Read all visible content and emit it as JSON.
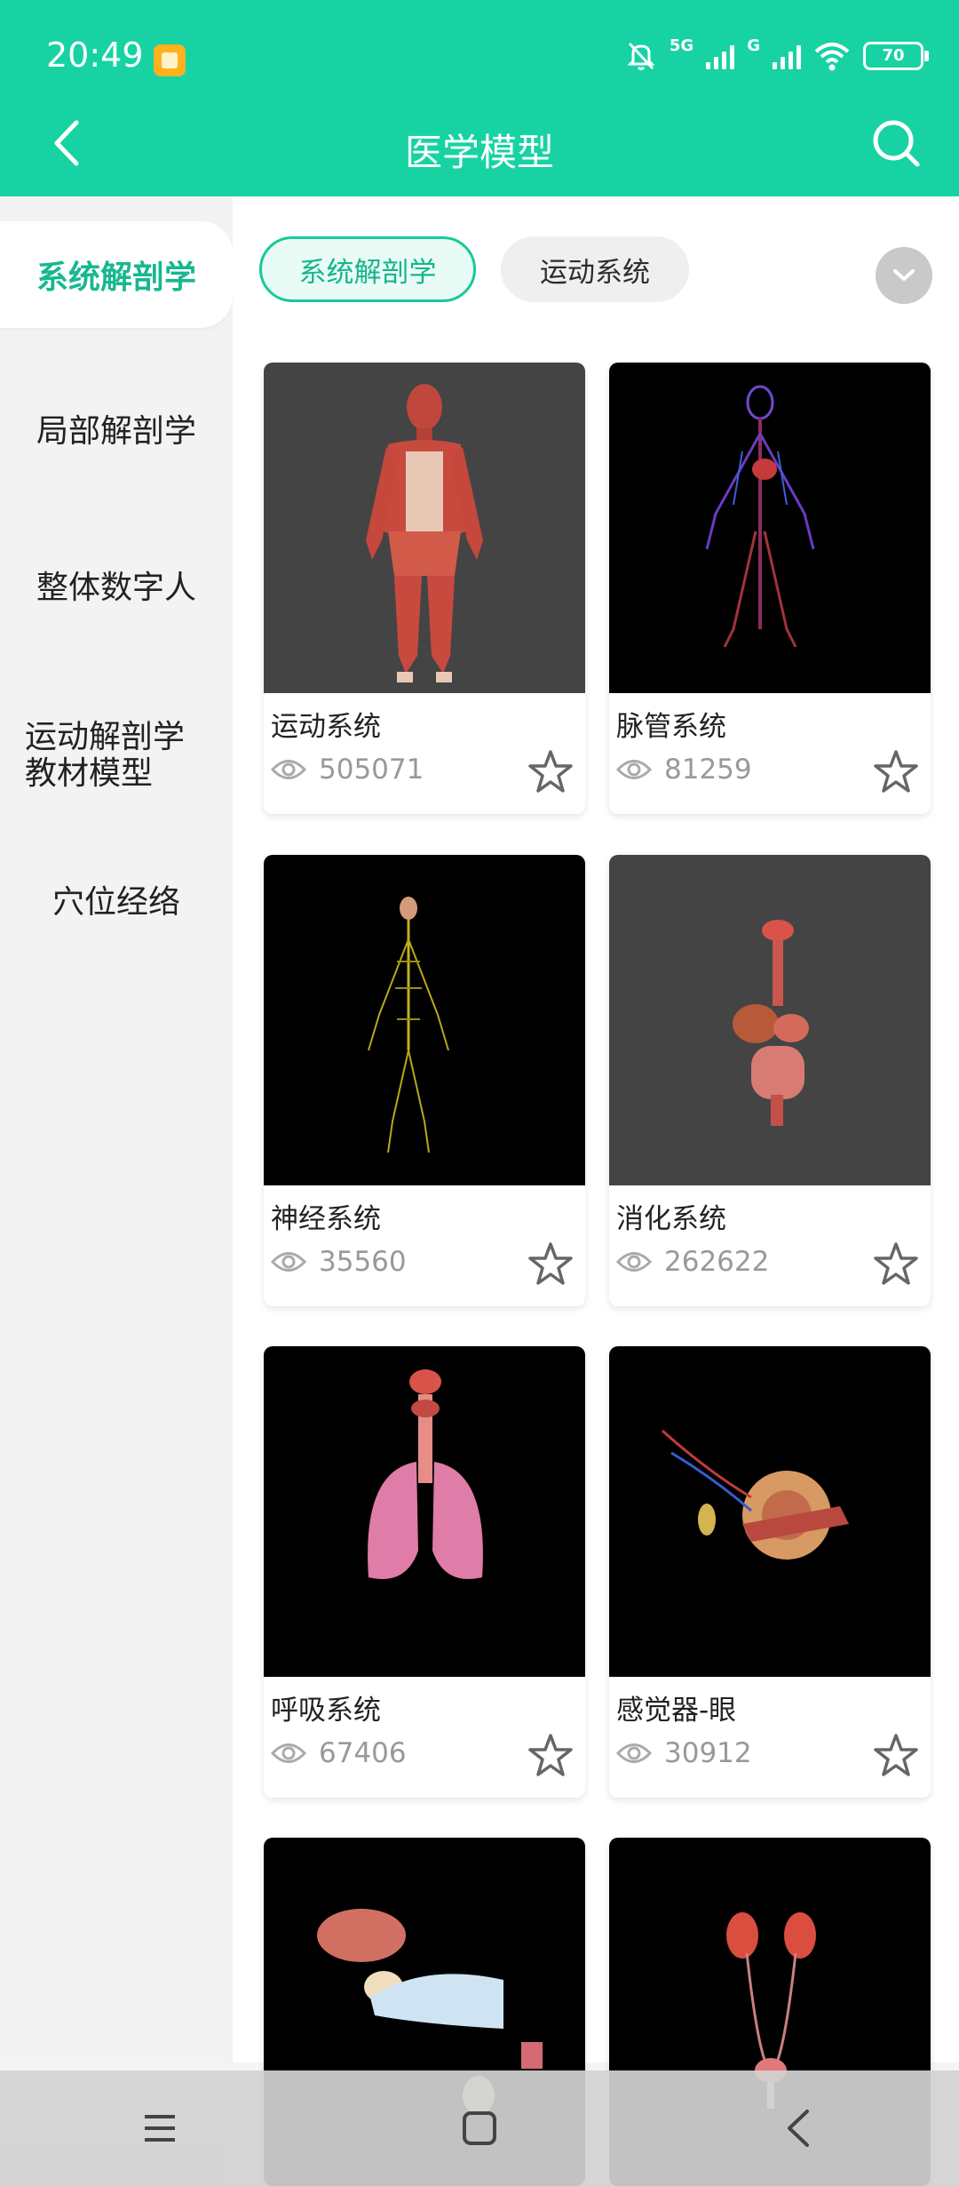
{
  "status": {
    "time": "20:49",
    "network": "5G",
    "network2": "G",
    "battery": "70"
  },
  "header": {
    "title": "医学模型"
  },
  "sidebar": {
    "items": [
      {
        "label": "系统解剖学"
      },
      {
        "label": "局部解剖学"
      },
      {
        "label": "整体数字人"
      },
      {
        "label": "运动解剖学\n教材模型",
        "line1": "运动解剖学",
        "line2": "教材模型"
      },
      {
        "label": "穴位经络"
      }
    ]
  },
  "filters": {
    "chips": [
      {
        "label": "系统解剖学"
      },
      {
        "label": "运动系统"
      }
    ]
  },
  "cards": [
    {
      "title": "运动系统",
      "views": "505071"
    },
    {
      "title": "脉管系统",
      "views": "81259"
    },
    {
      "title": "神经系统",
      "views": "35560"
    },
    {
      "title": "消化系统",
      "views": "262622"
    },
    {
      "title": "呼吸系统",
      "views": "67406"
    },
    {
      "title": "感觉器-眼",
      "views": "30912"
    }
  ],
  "icons": {
    "back": "chevron-left-icon",
    "search": "search-icon",
    "dropdown": "chevron-down-icon",
    "view": "eye-icon",
    "favorite": "star-icon",
    "nav_menu": "menu-icon",
    "nav_home": "square-icon",
    "nav_back": "back-icon"
  },
  "colors": {
    "accent": "#17d3a3",
    "accent_text": "#17b58d",
    "dark_bg": "#000000",
    "gray_bg": "#444444"
  }
}
